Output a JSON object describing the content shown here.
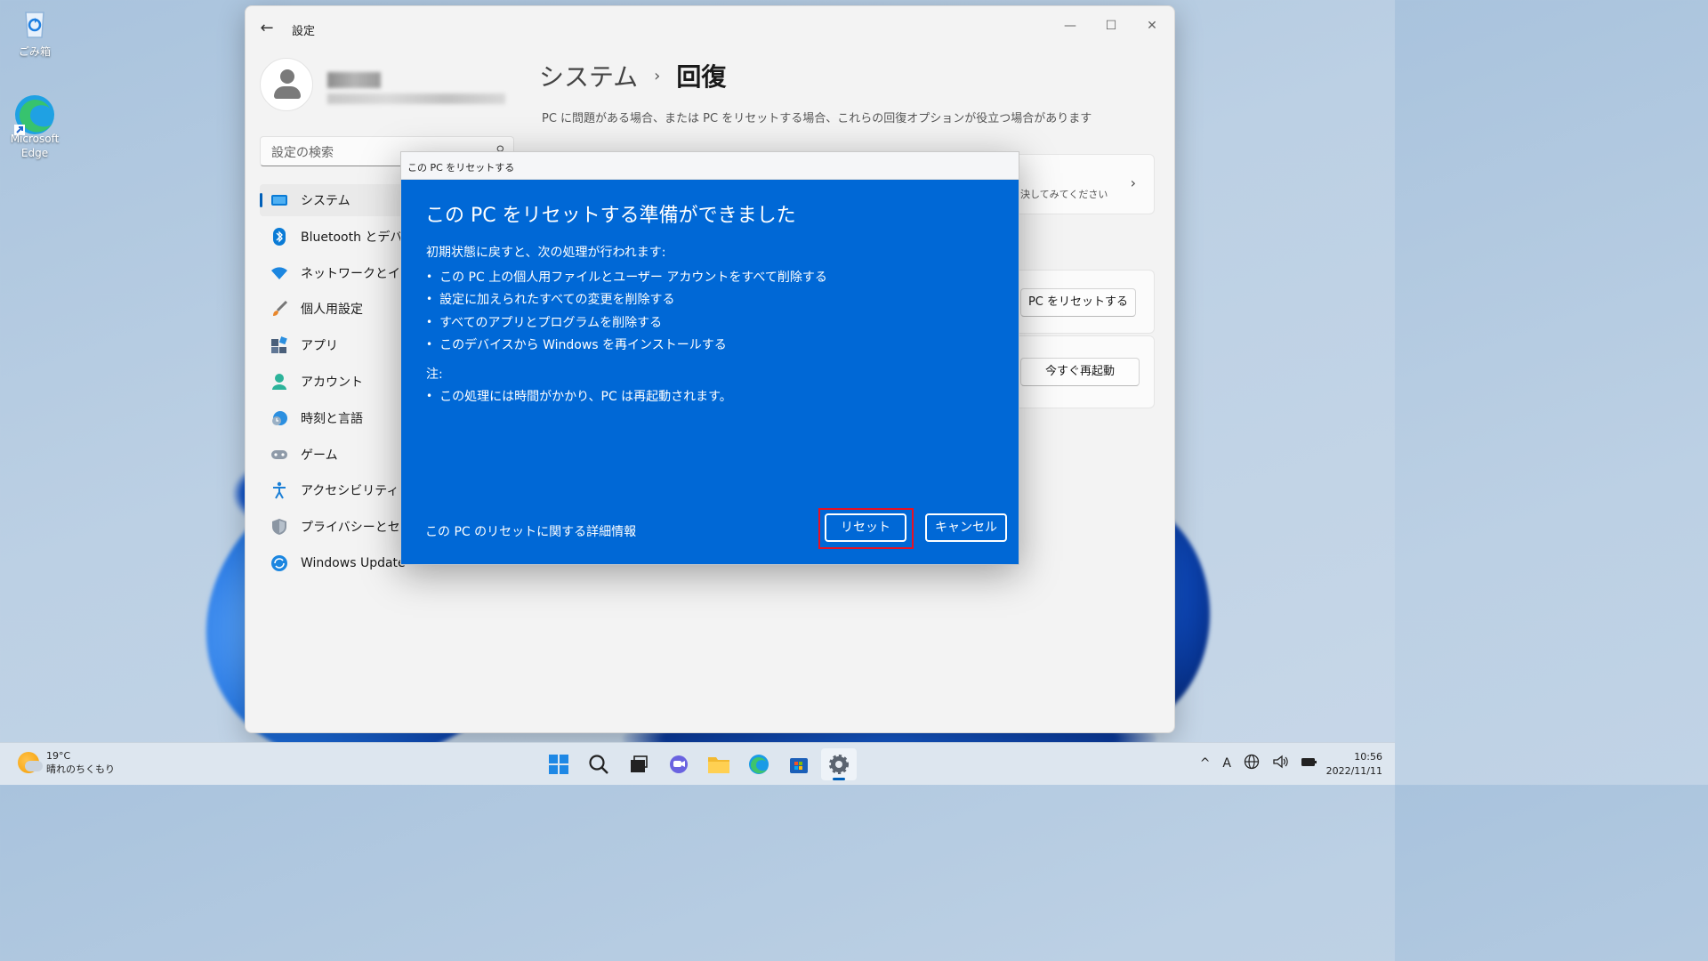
{
  "desktop": {
    "icons": [
      {
        "label": "ごみ箱",
        "icon": "recycle-bin-icon"
      },
      {
        "label": "Microsoft Edge",
        "icon": "edge-icon"
      }
    ]
  },
  "window": {
    "title": "設定",
    "controls": {
      "minimize": "—",
      "maximize": "☐",
      "close": "✕"
    }
  },
  "search": {
    "placeholder": "設定の検索"
  },
  "nav": {
    "items": [
      {
        "label": "システム",
        "icon": "system-icon",
        "active": true
      },
      {
        "label": "Bluetooth とデバイス",
        "icon": "bluetooth-icon"
      },
      {
        "label": "ネットワークとインターネット",
        "icon": "network-icon"
      },
      {
        "label": "個人用設定",
        "icon": "brush-icon"
      },
      {
        "label": "アプリ",
        "icon": "apps-icon"
      },
      {
        "label": "アカウント",
        "icon": "account-icon"
      },
      {
        "label": "時刻と言語",
        "icon": "time-language-icon"
      },
      {
        "label": "ゲーム",
        "icon": "gaming-icon"
      },
      {
        "label": "アクセシビリティ",
        "icon": "accessibility-icon"
      },
      {
        "label": "プライバシーとセキュリティ",
        "icon": "shield-icon"
      },
      {
        "label": "Windows Update",
        "icon": "update-icon"
      }
    ]
  },
  "page": {
    "breadcrumb_parent": "システム",
    "breadcrumb_separator": "›",
    "breadcrumb_current": "回復",
    "subtitle": "PC に問題がある場合、または PC をリセットする場合、これらの回復オプションが役立つ場合があります",
    "card1_text": "決してみてください",
    "reset_pc_button": "PC をリセットする",
    "restart_now_button": "今すぐ再起動"
  },
  "dialog": {
    "title": "この PC をリセットする",
    "heading": "この PC をリセットする準備ができました",
    "intro": "初期状態に戻すと、次の処理が行われます:",
    "actions": [
      "この PC 上の個人用ファイルとユーザー アカウントをすべて削除する",
      "設定に加えられたすべての変更を削除する",
      "すべてのアプリとプログラムを削除する",
      "このデバイスから Windows を再インストールする"
    ],
    "note_label": "注:",
    "notes": [
      "この処理には時間がかかり、PC は再起動されます。"
    ],
    "link": "この PC のリセットに関する詳細情報",
    "reset_button": "リセット",
    "cancel_button": "キャンセル"
  },
  "taskbar": {
    "weather_temp": "19°C",
    "weather_desc": "晴れのちくもり",
    "apps": [
      "start-icon",
      "search-icon",
      "task-view-icon",
      "chat-icon",
      "file-explorer-icon",
      "edge-icon",
      "store-icon",
      "settings-icon"
    ],
    "tray": {
      "chevron": "^",
      "ime": "A"
    },
    "time": "10:56",
    "date": "2022/11/11"
  },
  "colors": {
    "dialog_bg": "#0068d6",
    "accent": "#005fb8",
    "highlight": "#e81123"
  }
}
